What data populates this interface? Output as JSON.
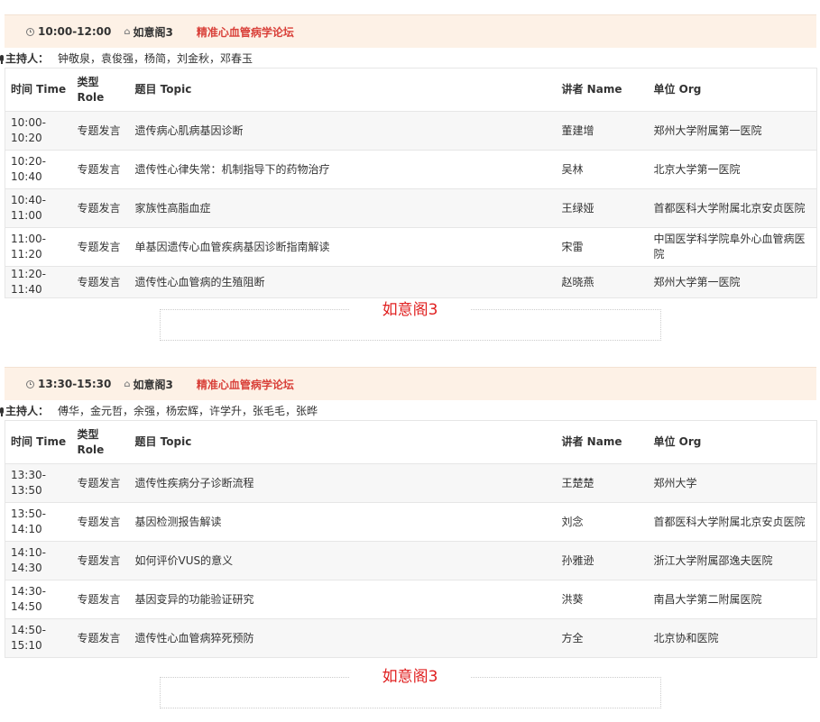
{
  "sessions": [
    {
      "time": "10:00-12:00",
      "room": "如意阁3",
      "forum": "精准心血管病学论坛",
      "host_label": "主持人：",
      "hosts": "钟敬泉，袁俊强，杨简，刘金秋，邓春玉",
      "headers": {
        "time": "时间 Time",
        "role": "类型 Role",
        "topic": "题目 Topic",
        "speaker": "讲者 Name",
        "org": "单位 Org"
      },
      "rows": [
        {
          "time": "10:00-10:20",
          "role": "专题发言",
          "topic": "遗传病心肌病基因诊断",
          "speaker": "董建增",
          "org": "郑州大学附属第一医院"
        },
        {
          "time": "10:20-10:40",
          "role": "专题发言",
          "topic": "遗传性心律失常：机制指导下的药物治疗",
          "speaker": "吴林",
          "org": "北京大学第一医院"
        },
        {
          "time": "10:40-11:00",
          "role": "专题发言",
          "topic": "家族性高脂血症",
          "speaker": "王绿娅",
          "org": "首都医科大学附属北京安贞医院"
        },
        {
          "time": "11:00-11:20",
          "role": "专题发言",
          "topic": "单基因遗传心血管疾病基因诊断指南解读",
          "speaker": "宋雷",
          "org": "中国医学科学院阜外心血管病医院"
        },
        {
          "time": "11:20-11:40",
          "role": "专题发言",
          "topic": "遗传性心血管病的生殖阻断",
          "speaker": "赵晓燕",
          "org": "郑州大学第一医院"
        }
      ],
      "venue": "如意阁3"
    },
    {
      "time": "13:30-15:30",
      "room": "如意阁3",
      "forum": "精准心血管病学论坛",
      "host_label": "主持人：",
      "hosts": "傅华，金元哲，余强，杨宏辉，许学升，张毛毛，张晔",
      "headers": {
        "time": "时间 Time",
        "role": "类型 Role",
        "topic": "题目 Topic",
        "speaker": "讲者 Name",
        "org": "单位 Org"
      },
      "rows": [
        {
          "time": "13:30-13:50",
          "role": "专题发言",
          "topic": "遗传性疾病分子诊断流程",
          "speaker": "王楚楚",
          "org": "郑州大学"
        },
        {
          "time": "13:50-14:10",
          "role": "专题发言",
          "topic": "基因检测报告解读",
          "speaker": "刘念",
          "org": "首都医科大学附属北京安贞医院"
        },
        {
          "time": "14:10-14:30",
          "role": "专题发言",
          "topic": "如何评价VUS的意义",
          "speaker": "孙雅逊",
          "org": "浙江大学附属邵逸夫医院"
        },
        {
          "time": "14:30-14:50",
          "role": "专题发言",
          "topic": "基因变异的功能验证研究",
          "speaker": "洪葵",
          "org": "南昌大学第二附属医院"
        },
        {
          "time": "14:50-15:10",
          "role": "专题发言",
          "topic": "遗传性心血管病猝死预防",
          "speaker": "方全",
          "org": "北京协和医院"
        }
      ],
      "venue": "如意阁3"
    }
  ]
}
